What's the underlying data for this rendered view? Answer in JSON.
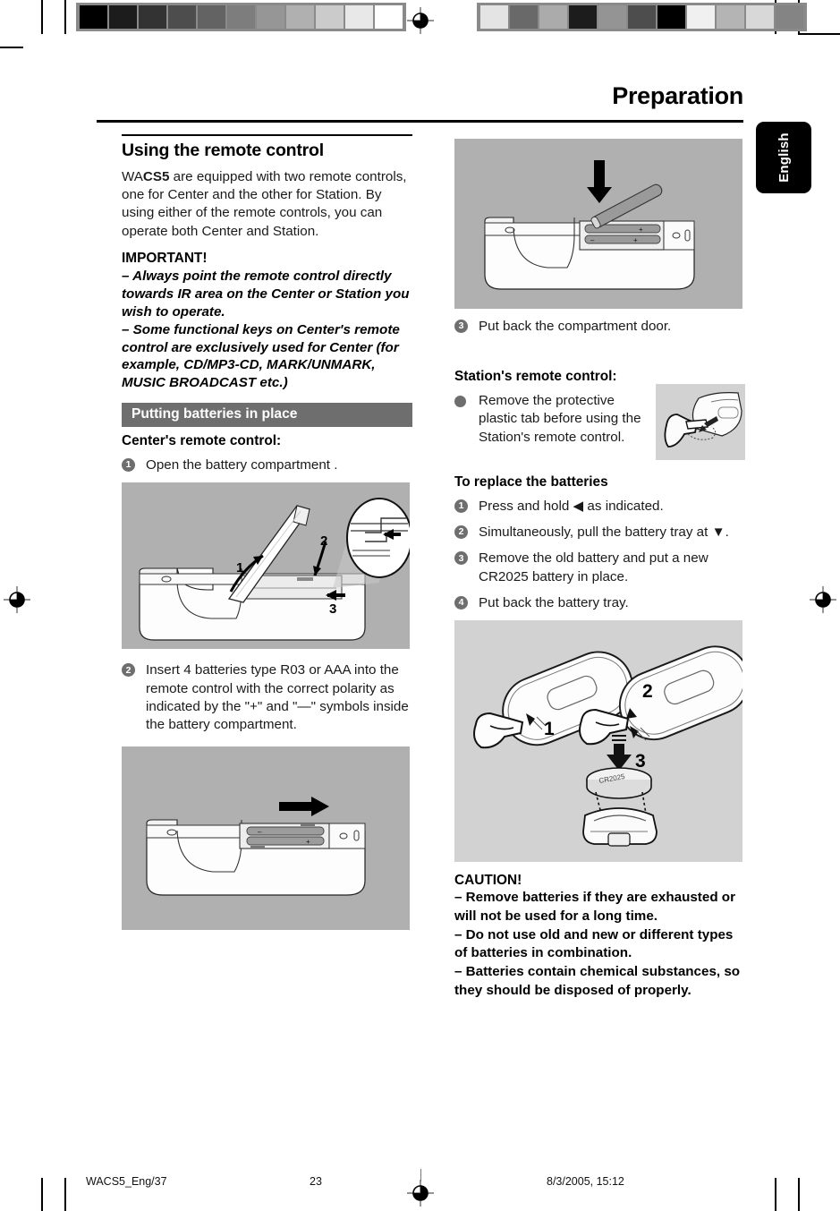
{
  "header": {
    "title": "Preparation",
    "language_tab": "English"
  },
  "left_column": {
    "section_heading": "Using the remote control",
    "intro_pre": "WA",
    "intro_bold": "CS5",
    "intro_rest": " are equipped with two remote controls, one for Center and the other for Station. By using either of the remote controls, you can operate both Center and Station.",
    "important_heading": "IMPORTANT!",
    "important_items": [
      "–   Always point the remote control directly towards IR area on the Center or Station you wish to operate.",
      "–   Some functional keys on Center's remote control are exclusively used for Center (for example, CD/MP3-CD, MARK/UNMARK, MUSIC BROADCAST etc.)"
    ],
    "bar_heading": "Putting batteries in place",
    "sub_heading": "Center's remote control:",
    "steps": [
      {
        "num": "1",
        "text": "Open the battery compartment ."
      },
      {
        "num": "2",
        "text": "Insert 4 batteries type R03 or AAA into the remote control with the correct polarity as indicated by the \"+\" and \"—\" symbols inside the battery compartment."
      }
    ],
    "figure_1_name": "remote-battery-door-open-illustration",
    "figure_2_name": "remote-battery-compartment-slide-illustration"
  },
  "right_column": {
    "figure_top_name": "inserting-aaa-batteries-illustration",
    "step_3": {
      "num": "3",
      "text": "Put back the compartment door."
    },
    "station_heading": "Station's remote control:",
    "station_bullet": "Remove the protective plastic tab before using the Station's remote control.",
    "station_figure_name": "plastic-tab-removal-illustration",
    "replace_heading": "To replace the batteries",
    "replace_steps": [
      {
        "num": "1",
        "text": "Press and hold ◀  as indicated."
      },
      {
        "num": "2",
        "text": "Simultaneously, pull the battery tray at  ▼."
      },
      {
        "num": "3",
        "text": "Remove the old battery and put a new CR2025 battery in place."
      },
      {
        "num": "4",
        "text": "Put back the battery tray."
      }
    ],
    "figure_bottom_name": "battery-tray-cr2025-replacement-illustration",
    "figure_bottom_labels": [
      "1",
      "2",
      "3"
    ],
    "caution_heading": "CAUTION!",
    "caution_items": [
      "–   Remove batteries if they are exhausted or will not be used for a long time.",
      "–   Do not use old and new or different types of batteries in combination.",
      "–   Batteries contain chemical substances, so they should be disposed of properly."
    ]
  },
  "footer": {
    "file_name": "WACS5_Eng/37",
    "page_number": "23",
    "timestamp": "8/3/2005, 15:12"
  },
  "calibration": {
    "left_bar_swatches": [
      "#000000",
      "#1c1c1c",
      "#333333",
      "#4d4d4d",
      "#636363",
      "#7d7d7d",
      "#969696",
      "#b0b0b0",
      "#cbcbcb",
      "#e8e8e8",
      "#ffffff"
    ],
    "right_bar_swatches": [
      "#e4e4e4",
      "#696969",
      "#ababab",
      "#1c1c1c",
      "#949494",
      "#4d4d4d",
      "#000000",
      "#f0f0f0",
      "#b4b4b4",
      "#d8d8d8",
      "#848484"
    ]
  },
  "colors": {
    "bar_heading_bg": "#6e6e6e",
    "figure_bg": "#b0b0b0",
    "figure_inline_bg": "#d2d2d2",
    "text": "#1a1a1a"
  }
}
